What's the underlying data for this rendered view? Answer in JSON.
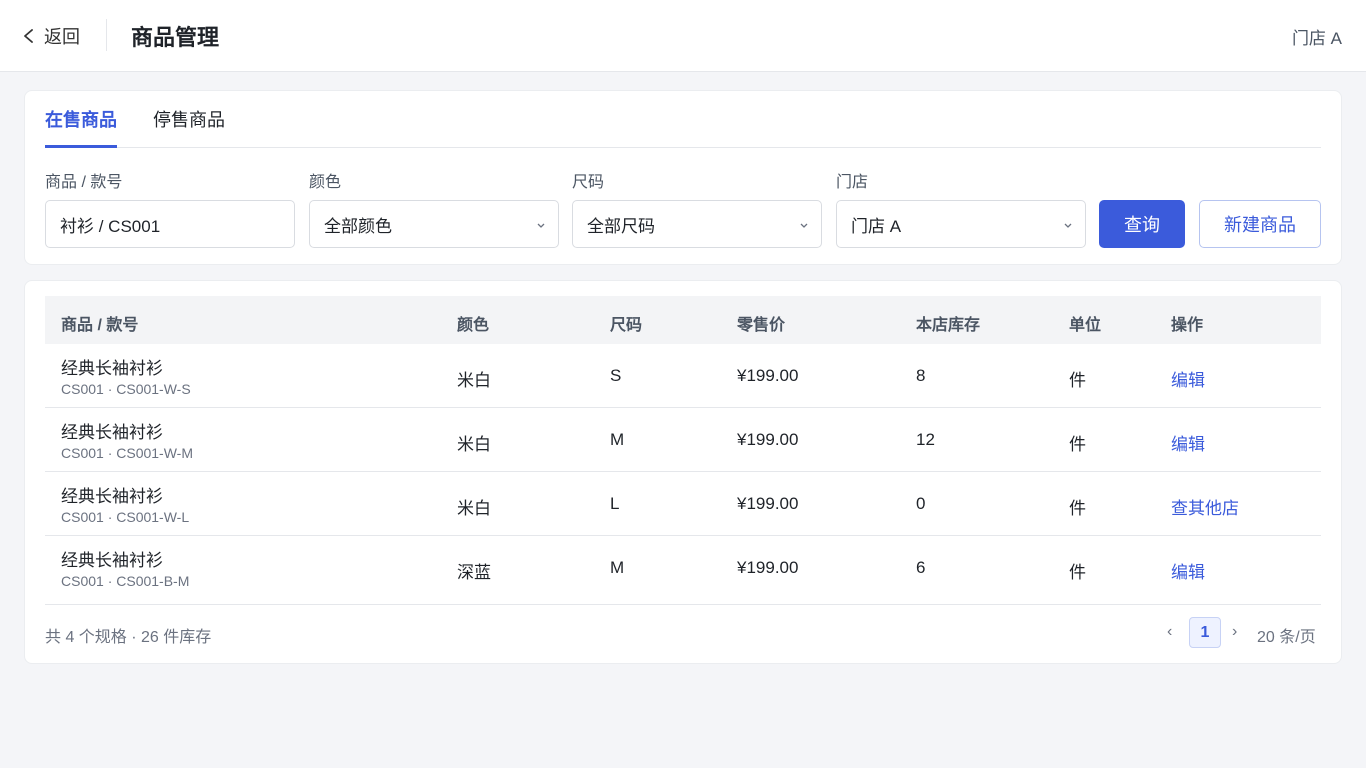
{
  "header": {
    "back_label": "返回",
    "title": "商品管理",
    "store": "门店 A"
  },
  "tabs": [
    {
      "label": "在售商品",
      "active": true
    },
    {
      "label": "停售商品",
      "active": false
    }
  ],
  "filters": {
    "product": {
      "label": "商品 / 款号",
      "value": "衬衫 / CS001"
    },
    "color": {
      "label": "颜色",
      "value": "全部颜色"
    },
    "size": {
      "label": "尺码",
      "value": "全部尺码"
    },
    "store": {
      "label": "门店",
      "value": "门店 A"
    },
    "query_label": "查询",
    "new_label": "新建商品"
  },
  "table": {
    "columns": [
      "商品 / 款号",
      "颜色",
      "尺码",
      "零售价",
      "本店库存",
      "单位",
      "操作"
    ],
    "rows": [
      {
        "name": "经典长袖衬衫",
        "sku": "CS001 · CS001-W-S",
        "color": "米白",
        "size": "S",
        "price": "¥199.00",
        "stock": "8",
        "unit": "件",
        "action": "编辑"
      },
      {
        "name": "经典长袖衬衫",
        "sku": "CS001 · CS001-W-M",
        "color": "米白",
        "size": "M",
        "price": "¥199.00",
        "stock": "12",
        "unit": "件",
        "action": "编辑"
      },
      {
        "name": "经典长袖衬衫",
        "sku": "CS001 · CS001-W-L",
        "color": "米白",
        "size": "L",
        "price": "¥199.00",
        "stock": "0",
        "unit": "件",
        "action": "查其他店"
      },
      {
        "name": "经典长袖衬衫",
        "sku": "CS001 · CS001-B-M",
        "color": "深蓝",
        "size": "M",
        "price": "¥199.00",
        "stock": "6",
        "unit": "件",
        "action": "编辑"
      }
    ]
  },
  "footer": {
    "summary": "共 4 个规格 · 26 件库存",
    "prev": "‹",
    "current_page": "1",
    "next": "›",
    "page_size": "20 条/页"
  },
  "colors": {
    "accent": "#3b5bdb",
    "background": "#f4f5f8"
  }
}
